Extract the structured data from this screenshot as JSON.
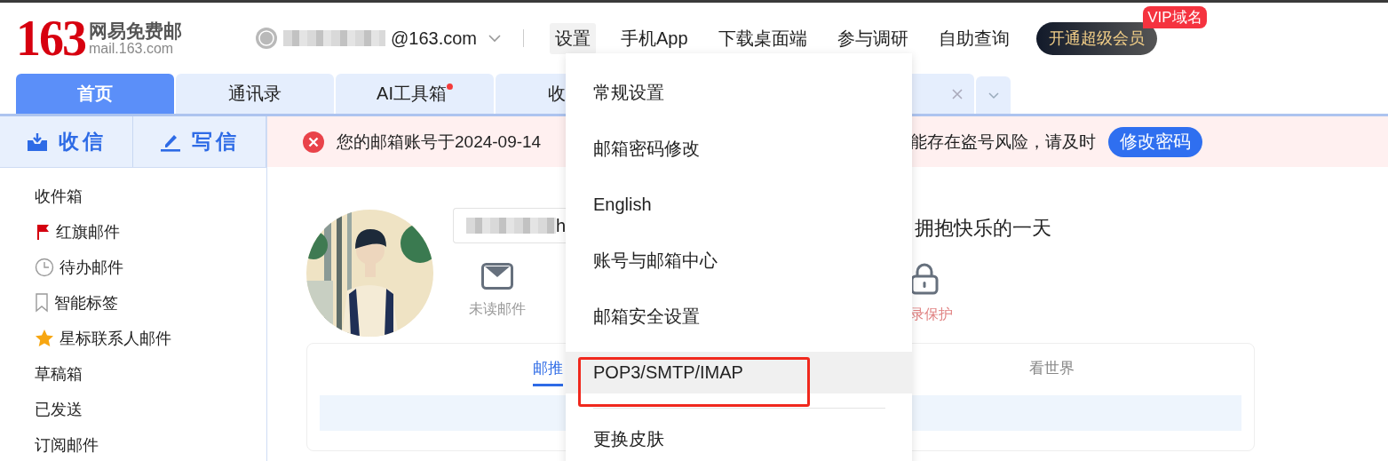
{
  "logo": {
    "number": "163",
    "name": "网易免费邮",
    "domain": "mail.163.com"
  },
  "account": {
    "email": "@163.com"
  },
  "nav": [
    {
      "label": "设置",
      "selected": true
    },
    {
      "label": "手机App",
      "selected": false
    },
    {
      "label": "下载桌面端",
      "selected": false
    },
    {
      "label": "参与调研",
      "selected": false
    },
    {
      "label": "自助查询",
      "selected": false
    }
  ],
  "vip": {
    "label": "开通超级会员",
    "badge": "VIP域名"
  },
  "tabs": [
    {
      "label": "首页",
      "selected": true,
      "dot": false
    },
    {
      "label": "通讯录",
      "selected": false,
      "dot": false
    },
    {
      "label": "AI工具箱",
      "selected": false,
      "dot": true
    },
    {
      "label": "收",
      "selected": false,
      "dot": false
    }
  ],
  "actions": [
    {
      "label": "收信",
      "kind": "receive"
    },
    {
      "label": "写信",
      "kind": "write"
    }
  ],
  "alert": {
    "text_start": "您的邮箱账号于2024-09-14",
    "text_end": "能存在盗号风险，请及时",
    "button": "修改密码"
  },
  "folders": [
    {
      "label": "收件箱",
      "kind": "plain"
    },
    {
      "label": "红旗邮件",
      "kind": "flag"
    },
    {
      "label": "待办邮件",
      "kind": "clock"
    },
    {
      "label": "智能标签",
      "kind": "bookmark"
    },
    {
      "label": "星标联系人邮件",
      "kind": "star"
    },
    {
      "label": "草稿箱",
      "kind": "plain"
    },
    {
      "label": "已发送",
      "kind": "plain"
    },
    {
      "label": "订阅邮件",
      "kind": "plain"
    }
  ],
  "profile": {
    "name": "h",
    "greeting": "拥抱快乐的一天",
    "stats": [
      {
        "label": "未读邮件",
        "kind": "mail"
      },
      {
        "label": "录保护",
        "kind": "lock"
      }
    ]
  },
  "feed_tabs": [
    {
      "label": "邮推",
      "selected": true
    },
    {
      "label": "看世界",
      "selected": false
    }
  ],
  "menu": {
    "items": [
      {
        "label": "常规设置",
        "selected": false,
        "divider_before": false
      },
      {
        "label": "邮箱密码修改",
        "selected": false,
        "divider_before": false
      },
      {
        "label": "English",
        "selected": false,
        "divider_before": false
      },
      {
        "label": "账号与邮箱中心",
        "selected": false,
        "divider_before": false
      },
      {
        "label": "邮箱安全设置",
        "selected": false,
        "divider_before": false
      },
      {
        "label": "POP3/SMTP/IMAP",
        "selected": true,
        "divider_before": false
      },
      {
        "label": "更换皮肤",
        "selected": false,
        "divider_before": true
      }
    ]
  }
}
